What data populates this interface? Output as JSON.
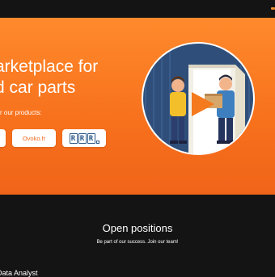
{
  "hero": {
    "title_line1": "arketplace for",
    "title_line2": "d car parts",
    "subtitle": "r our products:",
    "brands": [
      {
        "label": ""
      },
      {
        "label": "Ovoko.fr"
      },
      {
        "label": "RRR"
      }
    ]
  },
  "careers": {
    "title": "Open positions",
    "subtitle": "Be part of our success. Join our team!",
    "partial_text": "Data Analyst"
  },
  "colors": {
    "accent": "#f7701c",
    "dark": "#151414",
    "brand_blue": "#2e5a8a"
  }
}
